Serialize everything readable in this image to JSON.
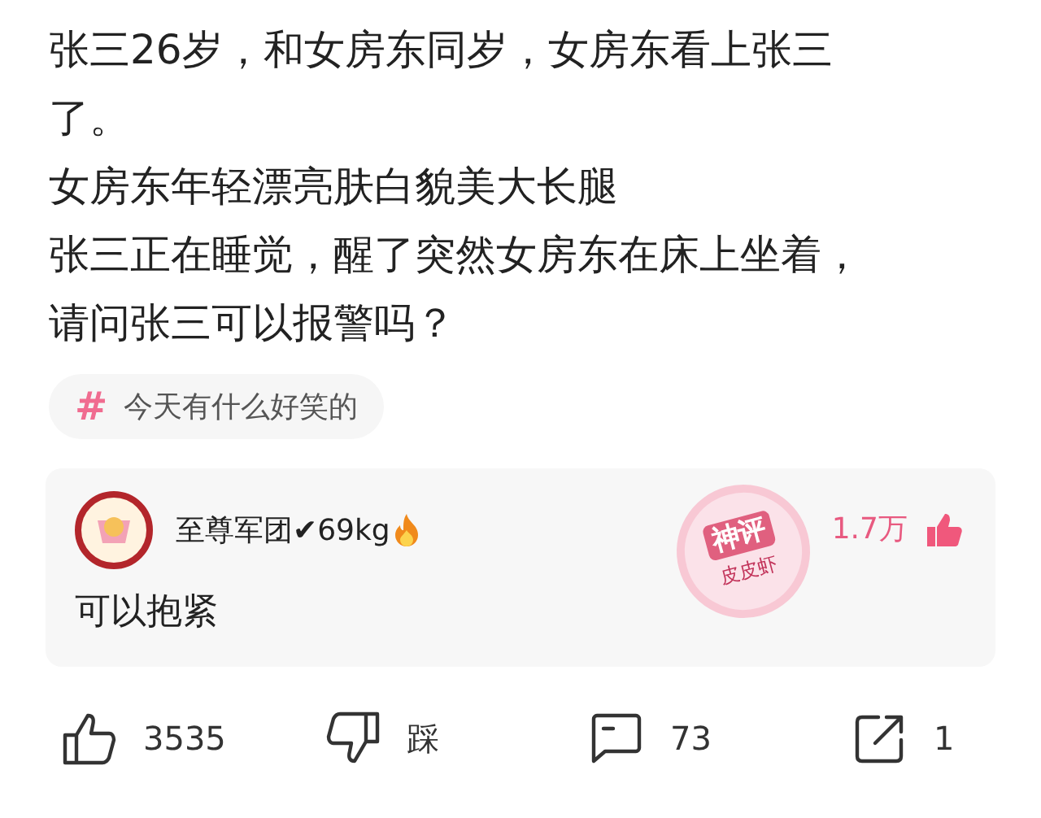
{
  "post": {
    "paragraphs": [
      [
        "张三26岁，和女房东同岁，女房东看上张三",
        "了。"
      ],
      [
        "女房东年轻漂亮肤白貌美大长腿"
      ],
      [
        "张三正在睡觉，醒了突然女房东在床上坐着，",
        "请问张三可以报警吗？"
      ]
    ]
  },
  "topic": {
    "symbol": "#",
    "label": "今天有什么好笑的"
  },
  "top_comment": {
    "user": "至尊军团✔69kg",
    "text": "可以抱紧",
    "badge": {
      "top": "神评",
      "bottom": "皮皮虾"
    },
    "likes": "1.7万",
    "liked": true
  },
  "actions": [
    {
      "kind": "like",
      "label": "3535"
    },
    {
      "kind": "dislike",
      "label": "踩"
    },
    {
      "kind": "comment",
      "label": "73"
    },
    {
      "kind": "share",
      "label": "1"
    }
  ]
}
